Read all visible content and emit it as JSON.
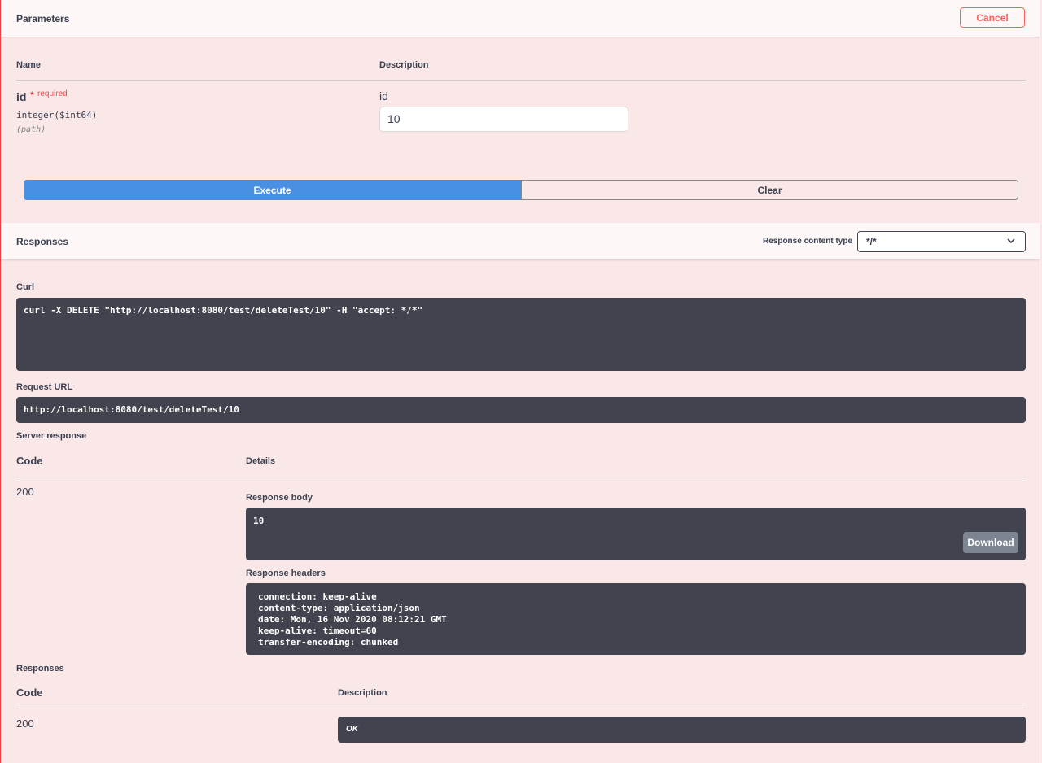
{
  "parameters": {
    "title": "Parameters",
    "cancel_label": "Cancel",
    "col_name": "Name",
    "col_description": "Description",
    "param": {
      "name": "id",
      "required_star": "*",
      "required_label": "required",
      "type": "integer($int64)",
      "location": "(path)",
      "description": "id",
      "value": "10"
    },
    "execute_label": "Execute",
    "clear_label": "Clear"
  },
  "responses_bar": {
    "title": "Responses",
    "content_type_label": "Response content type",
    "content_type_value": "*/*"
  },
  "curl": {
    "label": "Curl",
    "command": "curl -X DELETE \"http://localhost:8080/test/deleteTest/10\" -H \"accept: */*\""
  },
  "request_url": {
    "label": "Request URL",
    "value": "http://localhost:8080/test/deleteTest/10"
  },
  "server_response": {
    "label": "Server response",
    "col_code": "Code",
    "col_details": "Details",
    "code": "200",
    "body_label": "Response body",
    "body": "10",
    "download_label": "Download",
    "headers_label": "Response headers",
    "headers": [
      "connection: keep-alive",
      "content-type: application/json",
      "date: Mon, 16 Nov 2020 08:12:21 GMT",
      "keep-alive: timeout=60",
      "transfer-encoding: chunked"
    ]
  },
  "responses": {
    "label": "Responses",
    "col_code": "Code",
    "col_description": "Description",
    "code": "200",
    "description": "OK"
  },
  "colors": {
    "background": "#fae7e7",
    "accent_execute": "#4990e2",
    "cancel": "#ff6060",
    "code_bg": "#41444e"
  }
}
